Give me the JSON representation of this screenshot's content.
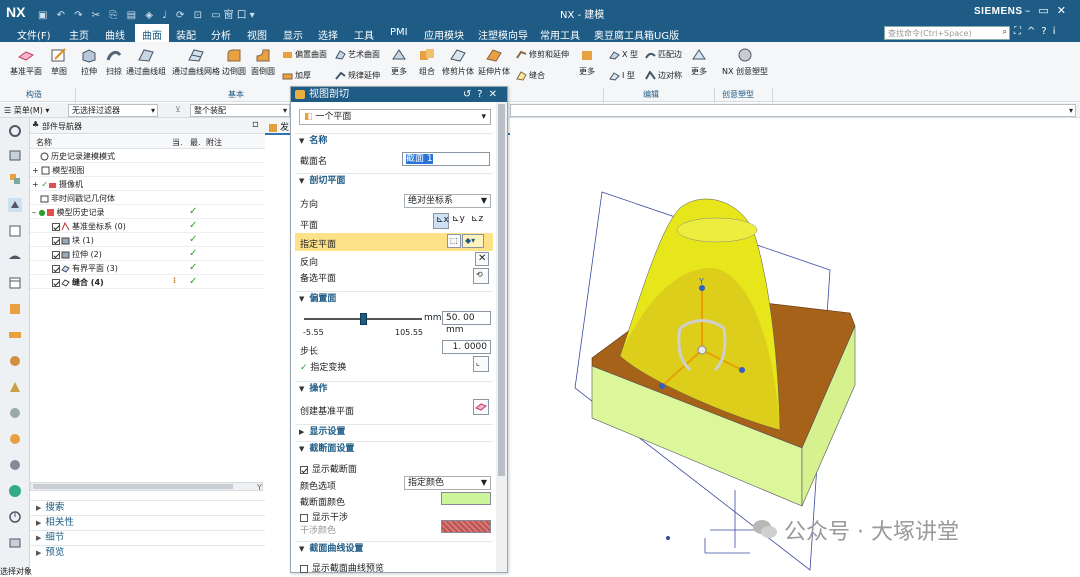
{
  "app": {
    "logo": "NX",
    "title": "NX - 建模",
    "brand": "SIEMENS",
    "quick_access_icons": [
      "save-icon",
      "undo-icon",
      "redo-icon",
      "cut-icon",
      "copy-icon",
      "paste-icon",
      "touch-mode-icon",
      "mic-icon",
      "repeat-icon",
      "view-icon",
      "window-icon"
    ],
    "window_menu_label": "窗口",
    "command_search_placeholder": "查找命令(Ctrl+Space)"
  },
  "menu": {
    "items": [
      "文件(F)",
      "主页",
      "曲线",
      "曲面",
      "装配",
      "分析",
      "视图",
      "显示",
      "选择",
      "工具",
      "PMI",
      "应用模块",
      "注塑模向导",
      "常用工具",
      "奥豆腐工具箱UG版"
    ],
    "active_index": 3
  },
  "ribbon": {
    "buttons": {
      "datum_plane": "基准平面",
      "sketch": "草图",
      "extrude": "拉伸",
      "sweep": "扫掠",
      "through_curve_group": "通过曲线组",
      "through_curve_mesh": "通过曲线网格",
      "edge_blend": "边倒圆",
      "face_blend": "面倒圆",
      "offset_surface": "偏置曲面",
      "art_surface": "艺术曲面",
      "thicken": "加厚",
      "law_extension": "规律延伸",
      "more1": "更多",
      "combine": "组合",
      "trim_sheet": "修剪片体",
      "trim_extend_sheet": "延伸片体",
      "trim_and_extend": "修剪和延伸",
      "sew": "缝合",
      "more2": "更多",
      "x_form": "X 型",
      "match_edge": "匹配边",
      "i_form": "I 型",
      "edge_symmetry": "边对称",
      "more3": "更多",
      "nx_realize_shape": "NX 创意塑型"
    },
    "groups": {
      "construct": "构造",
      "basic": "基本",
      "edit": "编辑",
      "creative_shape": "创意塑型"
    }
  },
  "selection_bar": {
    "menu_label": "菜单(M)",
    "type_filter": "无选择过滤器",
    "scope": "整个装配"
  },
  "part_navigator": {
    "title": "部件导航器",
    "columns": [
      "名称",
      "当.",
      "最.",
      "附注"
    ],
    "rows": [
      {
        "indent": 0,
        "icon": "clock-icon",
        "label": "历史记录建模模式",
        "check": ""
      },
      {
        "indent": 0,
        "icon": "model-views-icon",
        "label": "模型视图",
        "check": ""
      },
      {
        "indent": 0,
        "icon": "camera-icon",
        "label": "摄像机",
        "check": ""
      },
      {
        "indent": 0,
        "icon": "folder-icon",
        "label": "非时间戳记几何体",
        "check": ""
      },
      {
        "indent": 0,
        "icon": "history-icon",
        "label": "模型历史记录",
        "check": "✓"
      },
      {
        "indent": 1,
        "icon": "datum-csys-icon",
        "label": "基准坐标系 (0)",
        "check": "✓"
      },
      {
        "indent": 1,
        "icon": "block-icon",
        "label": "块 (1)",
        "check": "✓"
      },
      {
        "indent": 1,
        "icon": "extrude-icon",
        "label": "拉伸 (2)",
        "check": "✓"
      },
      {
        "indent": 1,
        "icon": "bounded-plane-icon",
        "label": "有界平面 (3)",
        "check": "✓"
      },
      {
        "indent": 1,
        "icon": "sew-icon",
        "label": "缝合 (4)",
        "check": "✓",
        "bold": true
      }
    ],
    "sections": [
      "搜索",
      "相关性",
      "细节",
      "预览"
    ]
  },
  "status_text": "选择对象",
  "viewport": {
    "tab_label": "发",
    "axis_label_y": "Y",
    "watermark": "公众号 · 大塚讲堂"
  },
  "dialog": {
    "title": "视图剖切",
    "type_value": "一个平面",
    "sections": {
      "name": "名称",
      "section_plane": "剖切平面",
      "offset": "偏置面",
      "operation": "操作",
      "display_settings": "显示设置",
      "section_face_settings": "截断面设置",
      "section_curve_settings": "截面曲线设置"
    },
    "name_label": "截面名",
    "name_value": "截面 1",
    "orientation_label": "方向",
    "orientation_value": "绝对坐标系",
    "plane_label": "平面",
    "specify_plane_label": "指定平面",
    "reverse_label": "反向",
    "alternate_plane_label": "备选平面",
    "offset_unit": "mm",
    "offset_value": "50. 00 mm",
    "slider_min": "-5.55",
    "slider_max": "105.55",
    "slider_fraction": 0.5,
    "step_label": "步长",
    "step_value": "1. 0000",
    "specify_transform_label": "指定变换",
    "create_datum_plane_label": "创建基准平面",
    "show_section_face_label": "显示截断面",
    "color_option_label": "颜色选项",
    "color_option_value": "指定颜色",
    "section_face_color_label": "截断面颜色",
    "section_face_color": "#cdf59a",
    "show_interference_label": "显示干涉",
    "interference_color_label": "干涉颜色",
    "interference_color": "#c0504d",
    "show_section_curve_preview_label": "显示截面曲线预览"
  },
  "colors": {
    "titlebar": "#1e5c86",
    "highlight": "#fde28a",
    "cone": "#e6e61a",
    "block_top": "#a86218",
    "block_front": "#dcf79a"
  }
}
